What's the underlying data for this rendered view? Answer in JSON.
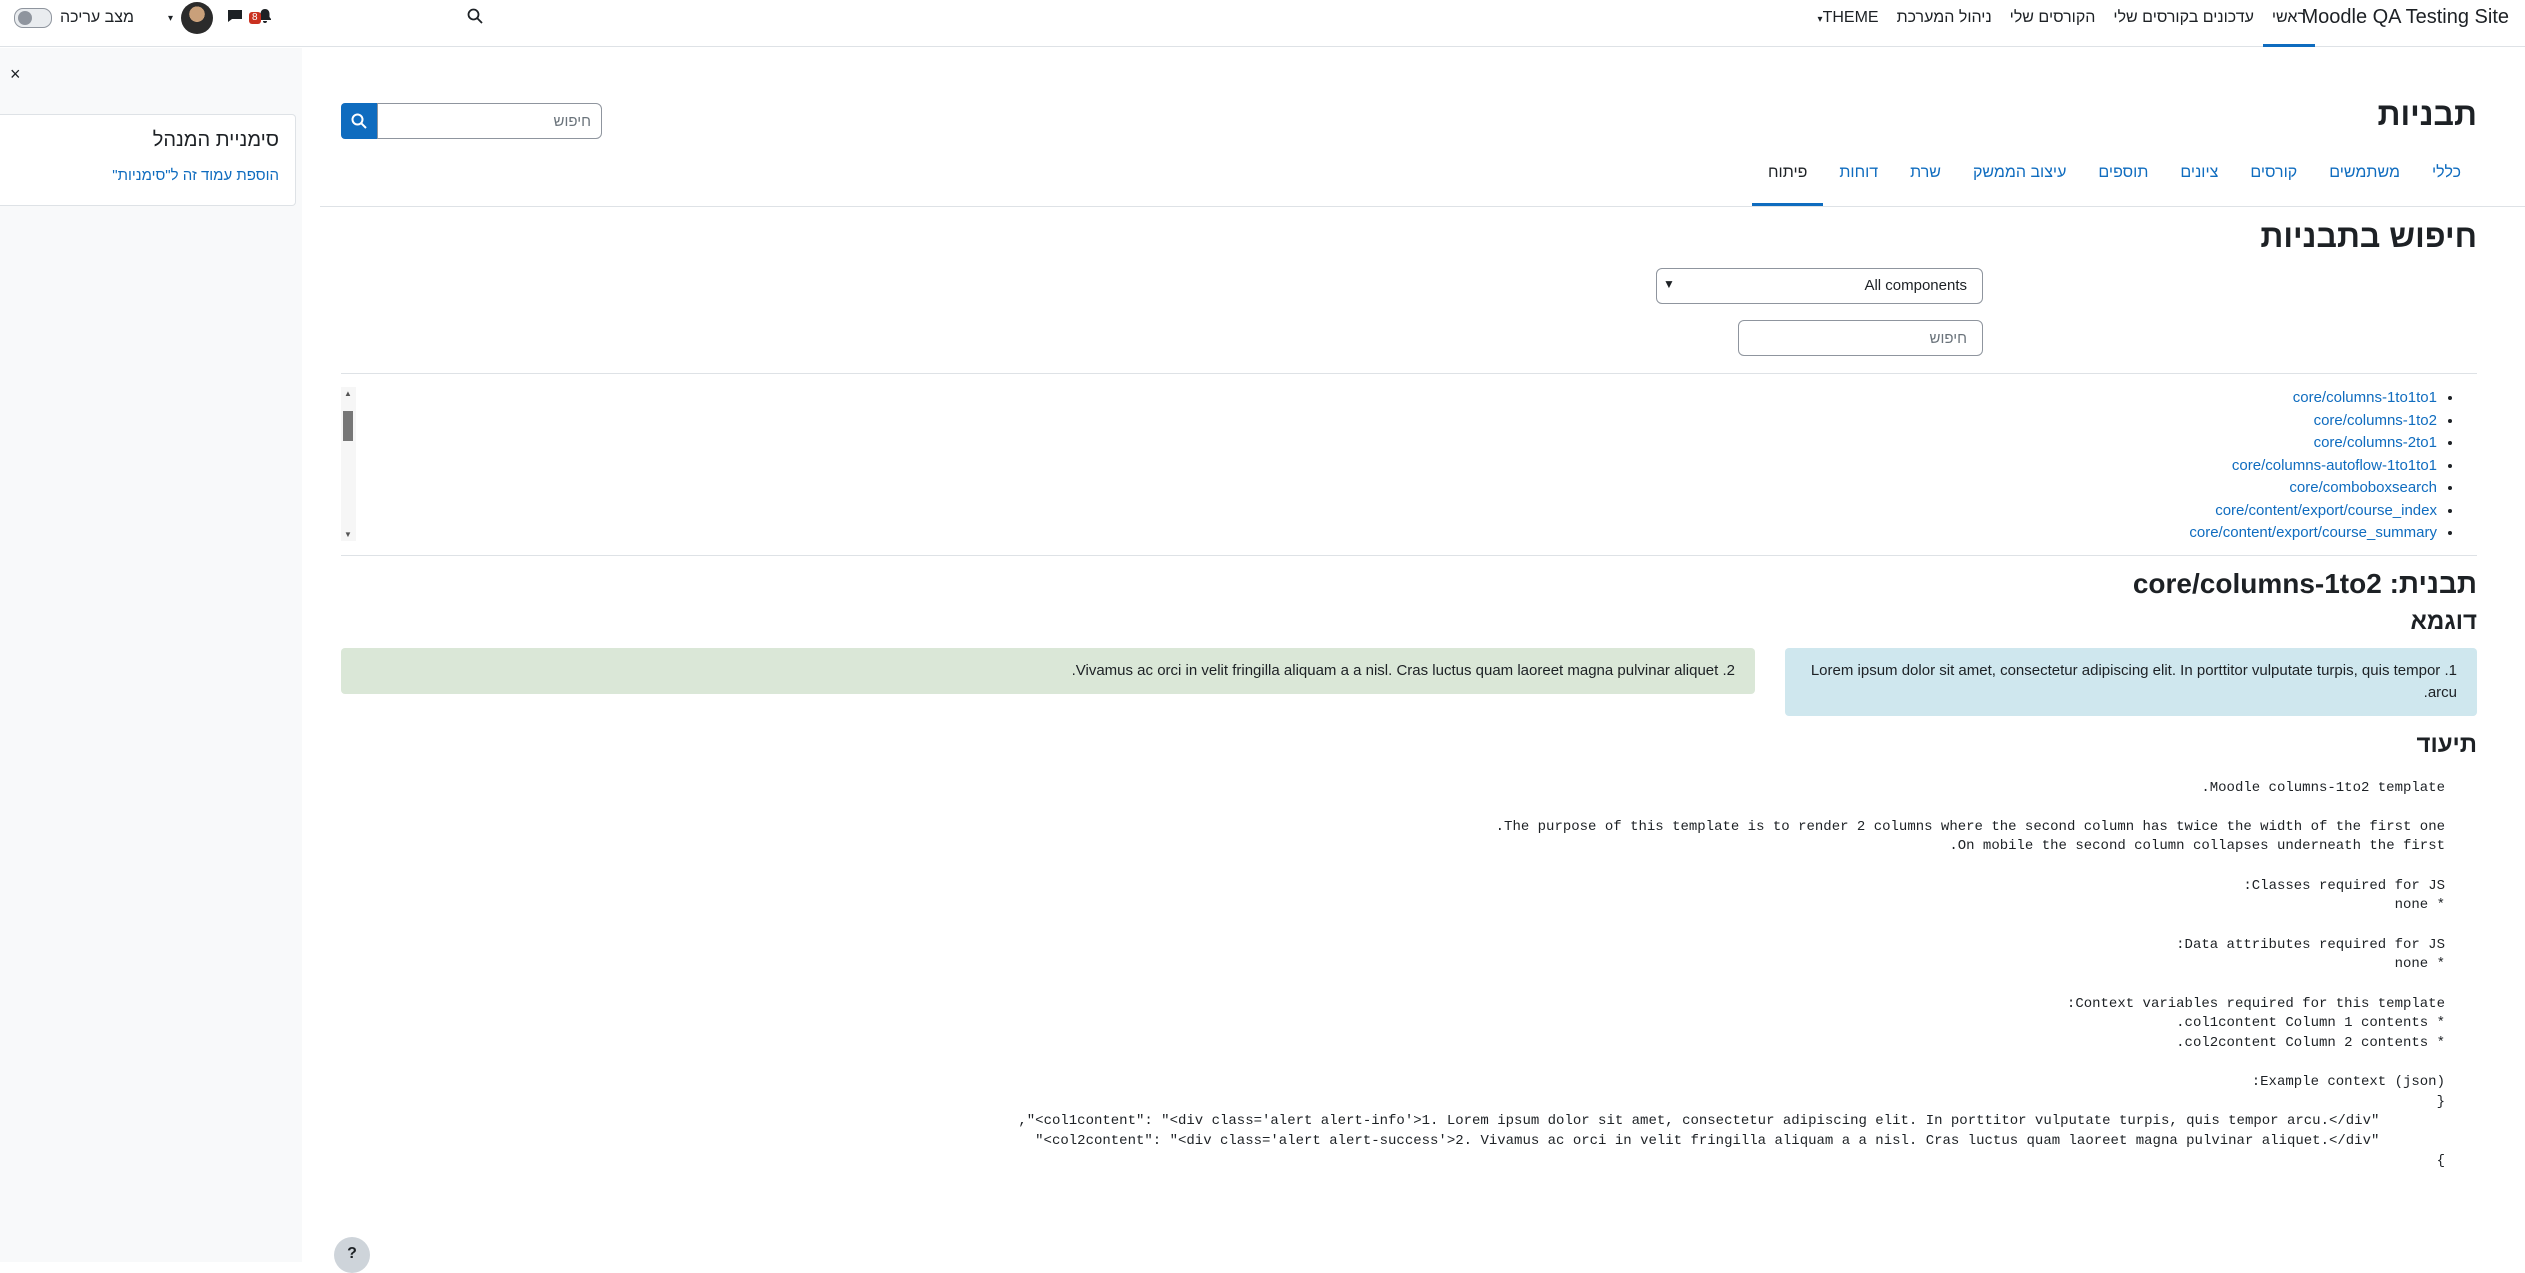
{
  "navbar": {
    "brand": "Moodle QA Testing Site",
    "items": [
      {
        "label": "ראשי"
      },
      {
        "label": "עדכונים בקורסים שלי"
      },
      {
        "label": "הקורסים שלי"
      },
      {
        "label": "ניהול המערכת"
      },
      {
        "label": "THEME"
      }
    ],
    "edit_mode_label": "מצב עריכה",
    "notification_count": "8"
  },
  "drawer": {
    "close_label": "×",
    "title": "סימניית המנהל",
    "link": "הוספת עמוד זה ל\"סימניות\""
  },
  "page": {
    "title": "תבניות",
    "search_placeholder": "חיפוש",
    "tabs": [
      {
        "label": "כללי"
      },
      {
        "label": "משתמשים"
      },
      {
        "label": "קורסים"
      },
      {
        "label": "ציונים"
      },
      {
        "label": "תוספים"
      },
      {
        "label": "עיצוב הממשק"
      },
      {
        "label": "שרת"
      },
      {
        "label": "דוחות"
      },
      {
        "label": "פיתוח"
      }
    ]
  },
  "template_search": {
    "heading": "חיפוש בתבניות",
    "component_selected": "All components",
    "search_placeholder": "חיפוש",
    "templates": [
      "core/columns-1to1to1",
      "core/columns-1to2",
      "core/columns-2to1",
      "core/columns-autoflow-1to1to1",
      "core/comboboxsearch",
      "core/content/export/course_index",
      "core/content/export/course_summary"
    ]
  },
  "template": {
    "heading": "תבנית: core/columns-1to2",
    "example_heading": "דוגמא",
    "col1": "1. Lorem ipsum dolor sit amet, consectetur adipiscing elit. In porttitor vulputate turpis, quis tempor arcu.",
    "col2": "2. Vivamus ac orci in velit fringilla aliquam a a nisl. Cras luctus quam laoreet magna pulvinar aliquet.",
    "docs_heading": "תיעוד",
    "docs": [
      "Moodle columns-1to2 template.",
      "",
      "The purpose of this template is to render 2 columns where the second column has twice the width of the first one.",
      "On mobile the second column collapses underneath the first.",
      "",
      "Classes required for JS:",
      "* none",
      "",
      "Data attributes required for JS:",
      "* none",
      "",
      "Context variables required for this template:",
      "* col1content Column 1 contents.",
      "* col2content Column 2 contents.",
      "",
      "Example context (json):",
      "{",
      "    \"col1content\": \"<div class='alert alert-info'>1. Lorem ipsum dolor sit amet, consectetur adipiscing elit. In porttitor vulputate turpis, quis tempor arcu.</div>\",",
      "    \"col2content\": \"<div class='alert alert-success'>2. Vivamus ac orci in velit fringilla aliquam a a nisl. Cras luctus quam laoreet magna pulvinar aliquet.</div>\"",
      "}"
    ]
  },
  "help_label": "?"
}
